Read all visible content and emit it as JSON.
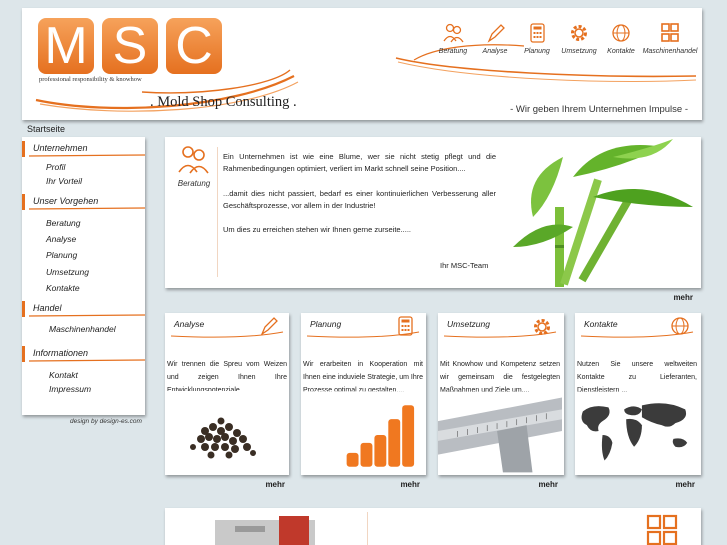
{
  "header": {
    "logo_letters": [
      "M",
      "S",
      "C"
    ],
    "tagline": "professional responsibility & knowhow",
    "company": ". Mold Shop Consulting .",
    "slogan": "- Wir geben Ihrem Unternehmen Impulse -",
    "nav": [
      {
        "label": "Beratung",
        "icon": "people-icon"
      },
      {
        "label": "Analyse",
        "icon": "pencil-icon"
      },
      {
        "label": "Planung",
        "icon": "calculator-icon"
      },
      {
        "label": "Umsetzung",
        "icon": "gear-icon"
      },
      {
        "label": "Kontakte",
        "icon": "globe-icon"
      },
      {
        "label": "Maschinenhandel",
        "icon": "machines-icon"
      }
    ],
    "accent": "#e5701f"
  },
  "breadcrumb": "Startseite",
  "sidebar": {
    "sections": [
      {
        "title": "Unternehmen",
        "items": [
          "Profil",
          "Ihr Vorteil"
        ]
      },
      {
        "title": "Unser Vorgehen",
        "items": [
          "Beratung",
          "Analyse",
          "Planung",
          "Umsetzung",
          "Kontakte"
        ]
      },
      {
        "title": "Handel",
        "items": [
          "Maschinenhandel"
        ]
      },
      {
        "title": "Informationen",
        "items": [
          "Kontakt",
          "Impressum"
        ]
      }
    ],
    "credits": "design by design-es.com"
  },
  "intro": {
    "label": "Beratung",
    "para1": "Ein Unternehmen ist wie eine Blume, wer sie nicht stetig pflegt und die Rahmenbedingungen optimiert, verliert im Markt schnell seine Position....",
    "para2": "...damit dies nicht passiert, bedarf es einer kontinuierlichen Verbesserung aller Geschäftsprozesse, vor allem in der Industrie!",
    "para3": "Um dies zu erreichen stehen wir Ihnen gerne zurseite.....",
    "signoff": "Ihr MSC-Team",
    "more": "mehr"
  },
  "cards": [
    {
      "title": "Analyse",
      "icon": "pencil-icon",
      "text": "Wir trennen die Spreu vom Weizen und zeigen Ihnen Ihre Entwicklungspotenziale..",
      "more": "mehr"
    },
    {
      "title": "Planung",
      "icon": "calculator-icon",
      "text": "Wir erarbeiten in Kooperation mit Ihnen eine induviele Strategie, um Ihre Prozesse optimal zu gestalten....",
      "more": "mehr"
    },
    {
      "title": "Umsetzung",
      "icon": "gear-icon",
      "text": "Mit Knowhow und Kompetenz setzen wir gemeinsam die festgelegten Maßnahmen und Ziele um....",
      "more": "mehr"
    },
    {
      "title": "Kontakte",
      "icon": "globe-icon",
      "text": "Nutzen Sie unsere weltweiten Kontakte zu Lieferanten, Dienstleistern ...",
      "more": "mehr"
    }
  ]
}
